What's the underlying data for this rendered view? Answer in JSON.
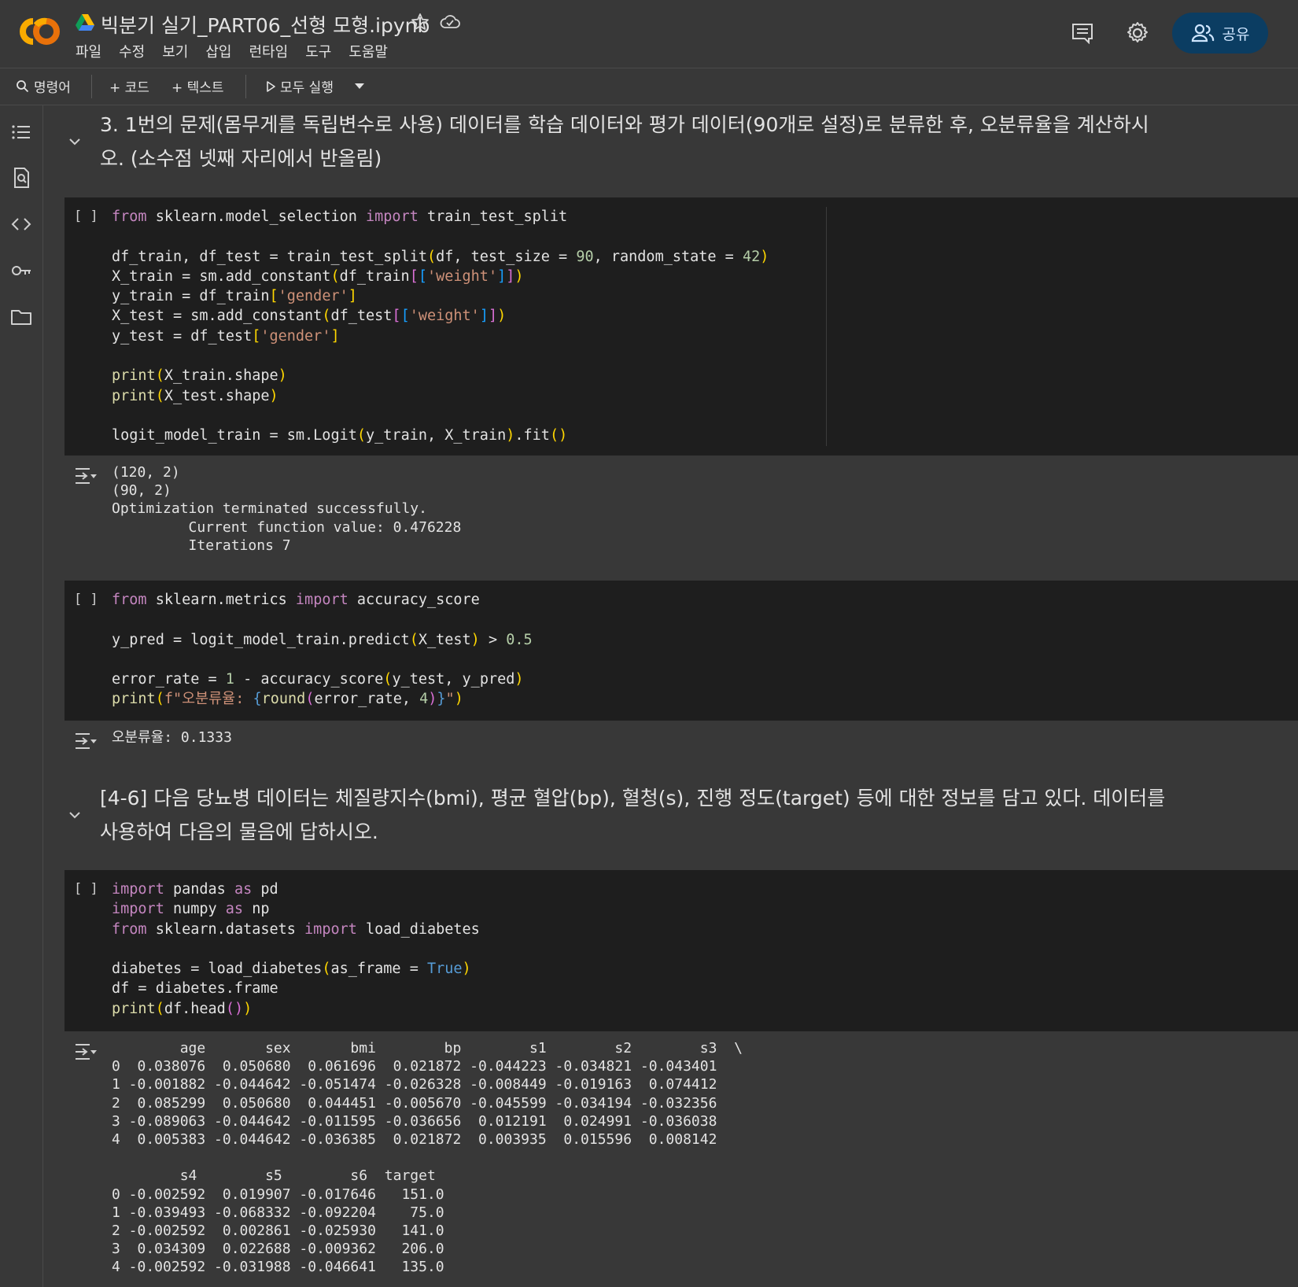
{
  "header": {
    "doc_title": "빅분기 실기_PART06_선형 모형.ipynb",
    "menu": [
      "파일",
      "수정",
      "보기",
      "삽입",
      "런타임",
      "도구",
      "도움말"
    ],
    "share_label": "공유"
  },
  "toolbar": {
    "command_label": "명령어",
    "add_code_label": "+ 코드",
    "add_text_label": "+ 텍스트",
    "run_all_label": "모두 실행"
  },
  "icons": {
    "logo": "colab-logo",
    "drive": "google-drive-icon",
    "star": "star-icon",
    "cloud": "cloud-icon",
    "comment": "comment-icon",
    "settings": "gear-icon",
    "share": "people-icon",
    "rail": [
      "toc-icon",
      "find-icon",
      "code-snippets-icon",
      "key-icon",
      "folder-icon"
    ]
  },
  "colors": {
    "bg": "#383838",
    "code_bg": "#1e1e1e",
    "share_bg": "#0b3d62",
    "logo_orange": "#f9ab00",
    "logo_dark_orange": "#e8710a"
  },
  "cells": {
    "md1": "3. 1번의 문제(몸무게를 독립변수로 사용) 데이터를 학습 데이터와 평가 데이터(90개로 설정)로 분류한 후, 오분류율을 계산하시오. (소수점 넷째 자리에서 반올림)",
    "code1_bracket": "[ ]",
    "code1_out": "(120, 2)\n(90, 2)\nOptimization terminated successfully.\n         Current function value: 0.476228\n         Iterations 7",
    "code2_bracket": "[ ]",
    "code2_out": "오분류율: 0.1333",
    "md2": "[4-6] 다음 당뇨병 데이터는 체질량지수(bmi), 평균 혈압(bp), 혈청(s), 진행 정도(target) 등에 대한 정보를 담고 있다. 데이터를 사용하여 다음의 물음에 답하시오.",
    "code3_bracket": "[ ]",
    "code3_out": "        age       sex       bmi        bp        s1        s2        s3  \\\n0  0.038076  0.050680  0.061696  0.021872 -0.044223 -0.034821 -0.043401\n1 -0.001882 -0.044642 -0.051474 -0.026328 -0.008449 -0.019163  0.074412\n2  0.085299  0.050680  0.044451 -0.005670 -0.045599 -0.034194 -0.032356\n3 -0.089063 -0.044642 -0.011595 -0.036656  0.012191  0.024991 -0.036038\n4  0.005383 -0.044642 -0.036385  0.021872  0.003935  0.015596  0.008142\n\n        s4        s5        s6  target\n0 -0.002592  0.019907 -0.017646   151.0\n1 -0.039493 -0.068332 -0.092204    75.0\n2 -0.002592  0.002861 -0.025930   141.0\n3  0.034309  0.022688 -0.009362   206.0\n4 -0.002592 -0.031988 -0.046641   135.0"
  },
  "code_tokens": {
    "c1": {
      "from": "from",
      "mod1": " sklearn.model_selection ",
      "import": "import",
      "name1": " train_test_split",
      "l3a": "df_train, df_test = train_test_split",
      "p1": "(",
      "l3b": "df, test_size = ",
      "n90": "90",
      "l3c": ", random_state = ",
      "n42": "42",
      "p2": ")",
      "l4a": "X_train = sm.add_constant",
      "l4b": "df_train",
      "sq1": "[",
      "sq2": "[",
      "s_weight": "'weight'",
      "sq3": "]",
      "sq4": "]",
      "l5a": "y_train = df_train",
      "s_gender": "'gender'",
      "l6a": "X_test = sm.add_constant",
      "l6b": "df_test",
      "l7a": "y_test = df_test",
      "print": "print",
      "l9": "X_train.shape",
      "l10": "X_test.shape",
      "l12a": "logit_model_train = sm.Logit",
      "l12b": "y_train, X_train",
      "l12c": ".fit",
      "empty_parens": "()"
    },
    "c2": {
      "from": "from",
      "mod": " sklearn.metrics ",
      "import": "import",
      "name": " accuracy_score",
      "l3a": "y_pred = logit_model_train.predict",
      "l3b": "X_test",
      "l3c": " > ",
      "n05": "0.5",
      "l5a": "error_rate = ",
      "n1": "1",
      "l5b": " - accuracy_score",
      "l5c": "y_test, y_pred",
      "print": "print",
      "fstr_a": "f\"오분류율: ",
      "brace_o": "{",
      "round": "round",
      "l6b": "error_rate, ",
      "n4": "4",
      "brace_c": "}",
      "fstr_b": "\""
    },
    "c3": {
      "import": "import",
      "from": "from",
      "as": "as",
      "l1": " pandas ",
      "pd": " pd",
      "l2": " numpy ",
      "np": " np",
      "l3": " sklearn.datasets ",
      "l3b": " load_diabetes",
      "l5a": "diabetes = load_diabetes",
      "l5b": "as_frame = ",
      "true": "True",
      "l6": "df = diabetes.frame",
      "print": "print",
      "l7": "df.head"
    }
  }
}
